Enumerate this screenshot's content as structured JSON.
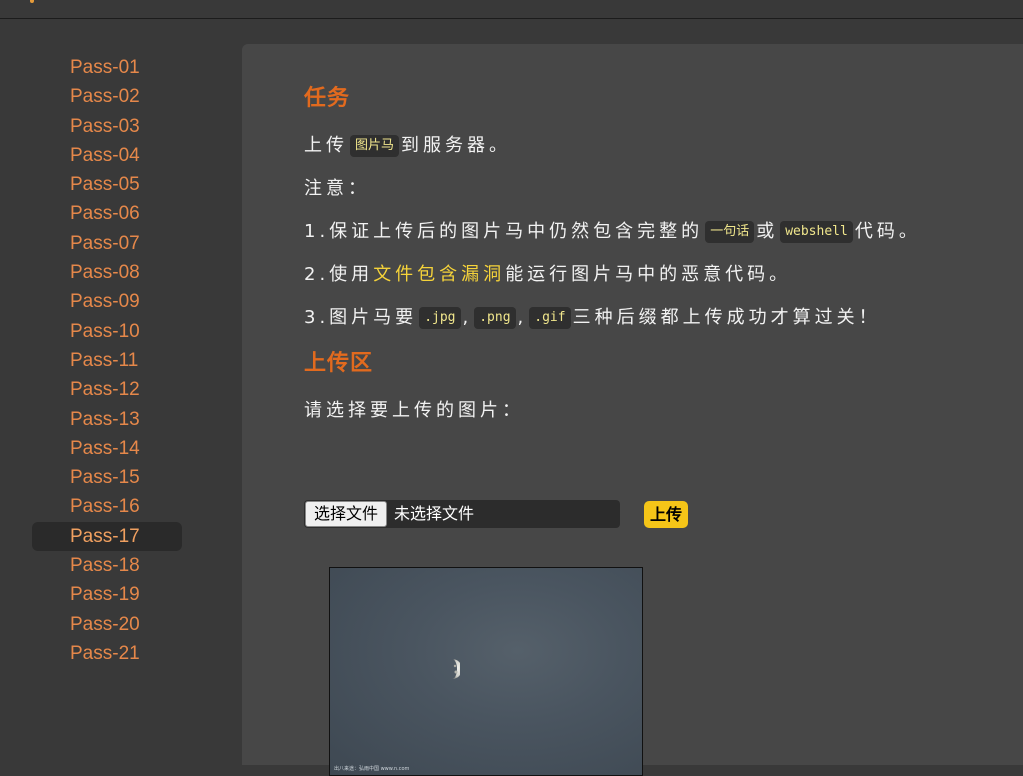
{
  "sidebar": {
    "items": [
      {
        "label": "Pass-01"
      },
      {
        "label": "Pass-02"
      },
      {
        "label": "Pass-03"
      },
      {
        "label": "Pass-04"
      },
      {
        "label": "Pass-05"
      },
      {
        "label": "Pass-06"
      },
      {
        "label": "Pass-07"
      },
      {
        "label": "Pass-08"
      },
      {
        "label": "Pass-09"
      },
      {
        "label": "Pass-10"
      },
      {
        "label": "Pass-11"
      },
      {
        "label": "Pass-12"
      },
      {
        "label": "Pass-13"
      },
      {
        "label": "Pass-14"
      },
      {
        "label": "Pass-15"
      },
      {
        "label": "Pass-16"
      },
      {
        "label": "Pass-17"
      },
      {
        "label": "Pass-18"
      },
      {
        "label": "Pass-19"
      },
      {
        "label": "Pass-20"
      },
      {
        "label": "Pass-21"
      }
    ],
    "active": "Pass-17"
  },
  "task": {
    "heading": "任务",
    "line1": {
      "pre": "上传",
      "code": "图片马",
      "post": "到服务器。"
    },
    "note_label": "注意：",
    "rule1": {
      "pre": "1.保证上传后的图片马中仍然包含完整的",
      "code1": "一句话",
      "mid": "或",
      "code2": "webshell",
      "post": "代码。"
    },
    "rule2": {
      "pre": "2.使用",
      "highlight": "文件包含漏洞",
      "post": "能运行图片马中的恶意代码。"
    },
    "rule3": {
      "pre": "3.图片马要",
      "code1": ".jpg",
      "sep1": ",",
      "code2": ".png",
      "sep2": ",",
      "code3": ".gif",
      "post": "三种后缀都上传成功才算过关！"
    }
  },
  "upload": {
    "heading": "上传区",
    "prompt": "请选择要上传的图片：",
    "choose_button": "选择文件",
    "file_status": "未选择文件",
    "submit_button": "上传"
  },
  "preview": {
    "watermark": "出八来途：弘雨中国 www.n.com"
  },
  "colors": {
    "accent": "#e26a1e",
    "nav_link": "#e6884a",
    "highlight": "#f5d33a",
    "button": "#f5c518"
  }
}
